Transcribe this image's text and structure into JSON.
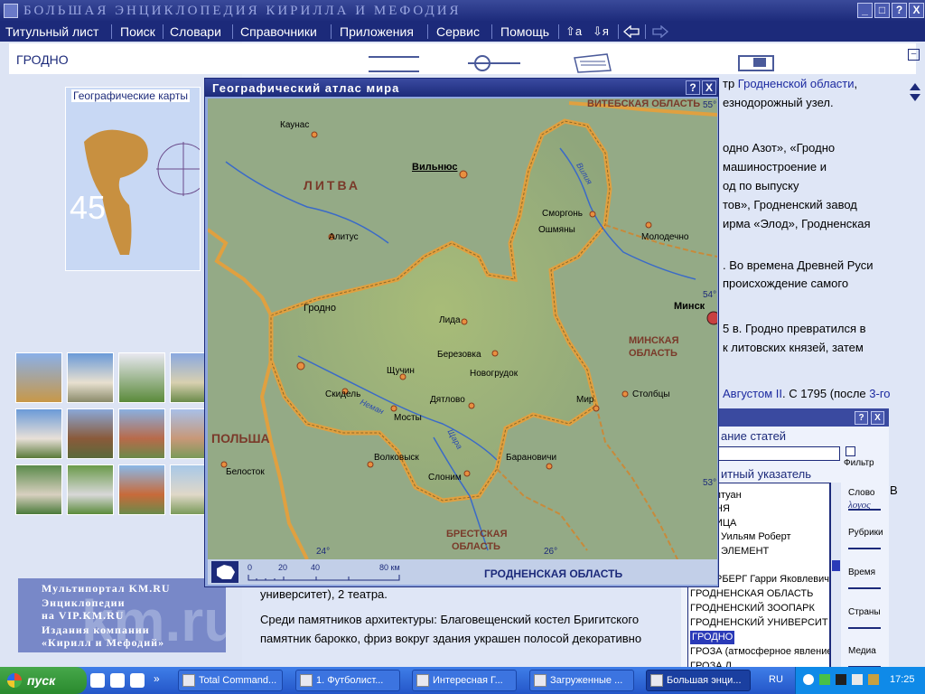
{
  "app": {
    "title": "БОЛЬШАЯ ЭНЦИКЛОПЕДИЯ КИРИЛЛА И МЕФОДИЯ",
    "window_buttons": [
      "_",
      "□",
      "?",
      "X"
    ]
  },
  "menu": {
    "items": [
      "Титульный лист",
      "Поиск",
      "Словари",
      "Справочники",
      "Приложения",
      "Сервис",
      "Помощь"
    ],
    "tools": [
      "⇧а",
      "⇩я"
    ]
  },
  "article": {
    "title": "ГРОДНО",
    "right_lines": [
      {
        "pre": "тр ",
        "link": "Гродненской области",
        "post": ","
      },
      {
        "pre": "езнодорожный узел.",
        "link": "",
        "post": ""
      },
      {
        "pre": "одно Азот», «Гродно",
        "link": "",
        "post": ""
      },
      {
        "pre": "машиностроение и",
        "link": "",
        "post": ""
      },
      {
        "pre": "од по выпуску",
        "link": "",
        "post": ""
      },
      {
        "pre": "тов», Гродненский завод",
        "link": "",
        "post": ""
      },
      {
        "pre": "ирма «Элод», Гродненская",
        "link": "",
        "post": ""
      },
      {
        "pre": ". Во времена Древней Руси",
        "link": "",
        "post": ""
      },
      {
        "pre": "происхождение самого",
        "link": "",
        "post": ""
      },
      {
        "pre": "5 в. Гродно превратился в",
        "link": "",
        "post": ""
      },
      {
        "pre": "к литовских князей, затем",
        "link": "",
        "post": ""
      },
      {
        "pre": "",
        "link": "Августом II",
        "post": ". С 1795 (после "
      },
      {
        "pre": "",
        "link": "3-го",
        "post": ""
      },
      {
        "pre": "университет), 2 театра.",
        "link": "",
        "post": ""
      },
      {
        "pre": "Среди памятников архитектуры: Благовещенский костел Бригитского",
        "link": "",
        "post": ""
      },
      {
        "pre": "памятник барокко, фриз вокруг здания украшен полосой декоративно",
        "link": "",
        "post": ""
      }
    ]
  },
  "left": {
    "geo_maps_label": "Географические карты",
    "geo_number": "45",
    "portal_lines": [
      "Мультипортал KM.RU",
      "Энциклопедии",
      "на VIP.KM.RU",
      "Издания компании",
      "«Кирилл и Мефодий»"
    ],
    "portal_bg": "km.ru"
  },
  "index_panel": {
    "header_buttons": [
      "?",
      "X"
    ],
    "heading1": "ание статей",
    "filter_label": "Фильтр",
    "heading2": "итный указатель",
    "items": [
      "птуан",
      "НЯ",
      "ИЦА",
      "Уильям Роберт",
      " ЭЛЕМЕНТ",
      "",
      "РБЕРГ Гарри Яковлевич",
      "ГРОДНЕНСКАЯ ОБЛАСТЬ",
      "ГРОДНЕНСКИЙ ЗООПАРК",
      "ГРОДНЕНСКИЙ УНИВЕРСИТ",
      "ГРОДНО",
      "ГРОЗА (атмосферное явление",
      "ГРОЗА Л..."
    ],
    "selected": "ГРОДНО",
    "side": [
      "Слово",
      "Рубрики",
      "Время",
      "Страны",
      "Медиа"
    ],
    "side_icons": [
      "λογος",
      "",
      "",
      "",
      ""
    ],
    "extra_letter": "В"
  },
  "atlas": {
    "title": "Географический атлас мира",
    "buttons": [
      "?",
      "X"
    ],
    "region": "ГРОДНЕНСКАЯ ОБЛАСТЬ",
    "scale_labels": [
      "0",
      "20",
      "40",
      "80 км"
    ],
    "map_labels": {
      "regions": [
        "ЛИТВА",
        "ПОЛЬША",
        "ВИТЕБСКАЯ ОБЛАСТЬ",
        "МИНСКАЯ",
        "ОБЛАСТЬ",
        "БРЕСТСКАЯ",
        "ОБЛАСТЬ"
      ],
      "cities": [
        "Каунас",
        "Вильнюс",
        "Алитус",
        "Сморгонь",
        "Ошмяны",
        "Молодечно",
        "Минск",
        "Лида",
        "Гродно",
        "Березовка",
        "Щучин",
        "Новогрудок",
        "Скидель",
        "Дятлово",
        "Мир",
        "Столбцы",
        "Мосты",
        "Волковыск",
        "Белосток",
        "Барановичи",
        "Слоним"
      ],
      "coords": [
        "55°",
        "54°",
        "53°",
        "24°",
        "26°"
      ],
      "rivers": [
        "Вилия",
        "Неман",
        "Щара"
      ]
    }
  },
  "taskbar": {
    "start": "пуск",
    "tasks": [
      "Total Command...",
      "1. Футболист...",
      "Интересная Г...",
      "Загруженные ...",
      "Большая энци..."
    ],
    "lang": "RU",
    "clock": "17:25"
  }
}
